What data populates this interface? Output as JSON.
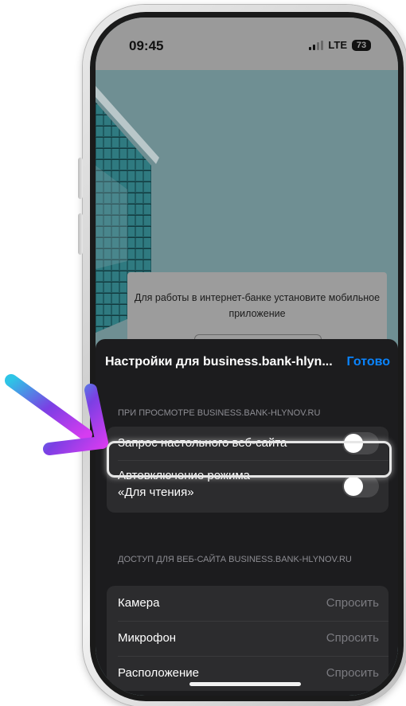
{
  "status_bar": {
    "time": "09:45",
    "network": "LTE",
    "battery": "73"
  },
  "web_page": {
    "card_text": "Для работы в интернет-банке установите мобильное приложение"
  },
  "settings_sheet": {
    "title": "Настройки для business.bank-hlyn...",
    "done_label": "Готово",
    "viewing_section": {
      "header": "ПРИ ПРОСМОТРЕ BUSINESS.BANK-HLYNOV.RU",
      "items": [
        {
          "label": "Запрос настольного веб-сайта",
          "enabled": false
        },
        {
          "label_line1": "Автовключение режима",
          "label_line2": "«Для чтения»",
          "enabled": false
        }
      ]
    },
    "access_section": {
      "header": "ДОСТУП ДЛЯ ВЕБ-САЙТА BUSINESS.BANK-HLYNOV.RU",
      "items": [
        {
          "label": "Камера",
          "value": "Спросить"
        },
        {
          "label": "Микрофон",
          "value": "Спросить"
        },
        {
          "label": "Расположение",
          "value": "Спросить"
        }
      ]
    }
  },
  "colors": {
    "accent": "#0a84ff",
    "sheet_bg": "#1c1c1e",
    "group_bg": "#2c2c2e",
    "arrow_gradient": [
      "#2ec4e6",
      "#7b3fe4",
      "#d63cf0"
    ]
  },
  "icons": [
    "signal-icon",
    "battery-icon",
    "arrow-pointer-icon"
  ]
}
